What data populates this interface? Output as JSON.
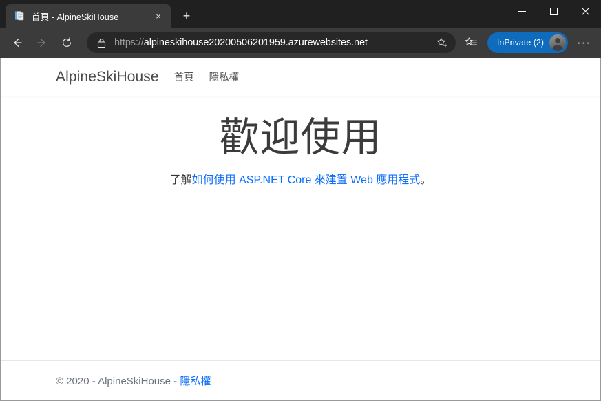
{
  "browser": {
    "tab": {
      "title": "首頁 - AlpineSkiHouse",
      "favicon_name": "page-favicon",
      "close_label": "×"
    },
    "new_tab_label": "+",
    "window_controls": {
      "minimize": "—",
      "maximize": "□",
      "close": "✕"
    },
    "toolbar": {
      "back_label": "←",
      "forward_label": "→",
      "refresh_label": "↻",
      "lock_icon": "lock-icon",
      "url_scheme": "https://",
      "url_host": "alpineskihouse20200506201959.azurewebsites.net",
      "url_full": "https://alpineskihouse20200506201959.azurewebsites.net",
      "favorite_icon": "star-plus-icon",
      "collections_icon": "favorites-list-icon",
      "inprivate_label": "InPrivate (2)",
      "avatar_name": "profile-avatar",
      "more_label": "···"
    },
    "colors": {
      "tabstrip_bg": "#202020",
      "toolbar_bg": "#3b3b3b",
      "address_bg": "#272727",
      "inprivate_blue": "#0f6cbd"
    }
  },
  "page": {
    "brand": "AlpineSkiHouse",
    "nav": [
      {
        "label": "首頁"
      },
      {
        "label": "隱私權"
      }
    ],
    "hero": {
      "heading": "歡迎使用",
      "paragraph_prefix": "了解",
      "paragraph_link": "如何使用 ASP.NET Core 來建置 Web 應用程式",
      "paragraph_suffix": "。"
    },
    "footer": {
      "text": "© 2020 - AlpineSkiHouse - ",
      "link": "隱私權"
    },
    "colors": {
      "link": "#0d6efd",
      "heading": "#3b3b3b",
      "footer_text": "#6c757d"
    }
  }
}
